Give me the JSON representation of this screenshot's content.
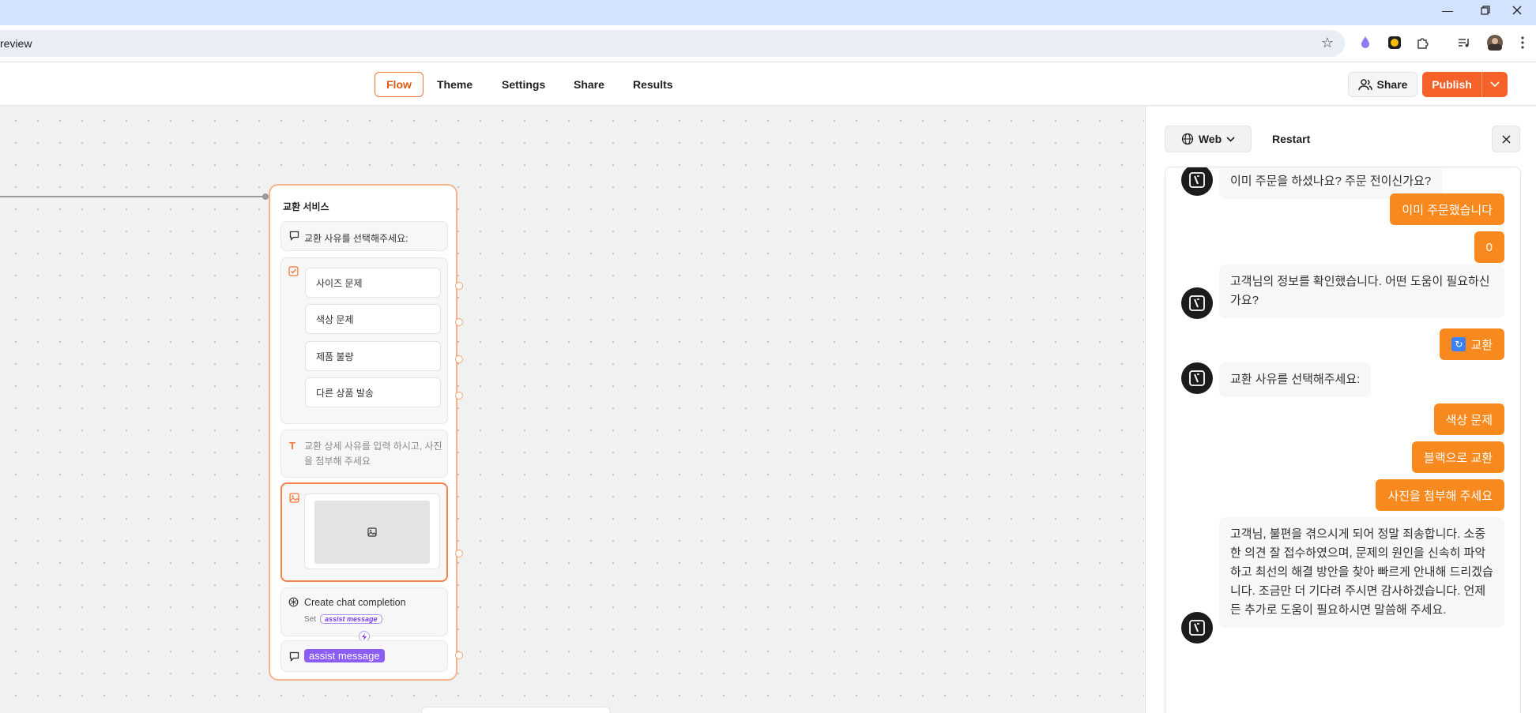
{
  "browser": {
    "url": "review",
    "window_controls": [
      "minimize",
      "restore",
      "close"
    ],
    "extensions": [
      "puzzle-icon",
      "media-icon",
      "profile-icon",
      "menu-icon"
    ]
  },
  "header": {
    "tabs": [
      "Flow",
      "Theme",
      "Settings",
      "Share",
      "Results"
    ],
    "active_tab": "Flow",
    "share_label": "Share",
    "publish_label": "Publish"
  },
  "canvas": {
    "group": {
      "title": "교환 서비스",
      "text_bubble": "교환 사유를 선택해주세요:",
      "options": [
        "사이즈 문제",
        "색상 문제",
        "제품 불량",
        "다른 상품 발송"
      ],
      "text_input_placeholder": "교환 상세 사유를 입력 하시고, 사진을 첨부해 주세요",
      "openai_block": "Create chat completion",
      "openai_set_label": "Set",
      "openai_set_variable": "assist message",
      "message_variable": "assist message"
    }
  },
  "preview": {
    "web_label": "Web",
    "restart_label": "Restart",
    "messages": [
      {
        "role": "bot",
        "text": "이미 주문을 하셨나요? 주문 전이신가요?"
      },
      {
        "role": "user",
        "text": "이미 주문했습니다"
      },
      {
        "role": "user",
        "text": "0"
      },
      {
        "role": "bot",
        "text": "고객님의 정보를 확인했습니다. 어떤 도움이 필요하신가요?"
      },
      {
        "role": "user",
        "text": "교환"
      },
      {
        "role": "bot",
        "text": "교환 사유를 선택해주세요:"
      },
      {
        "role": "user",
        "text": "색상 문제"
      },
      {
        "role": "user",
        "text": "블랙으로 교환"
      },
      {
        "role": "user",
        "text": "사진을 첨부해 주세요"
      },
      {
        "role": "bot",
        "text": "고객님, 불편을 겪으시게 되어 정말 죄송합니다. 소중한 의견 잘 접수하였으며, 문제의 원인을 신속히 파악하고 최선의 해결 방안을 찾아 빠르게 안내해 드리겠습니다. 조금만 더 기다려 주시면 감사하겠습니다. 언제든 추가로 도움이 필요하시면 말씀해 주세요."
      }
    ]
  },
  "colors": {
    "accent": "#f4622a",
    "user_bubble": "#f7891f",
    "group_border": "#f6b38c",
    "variable_badge": "#8b5cf6"
  }
}
